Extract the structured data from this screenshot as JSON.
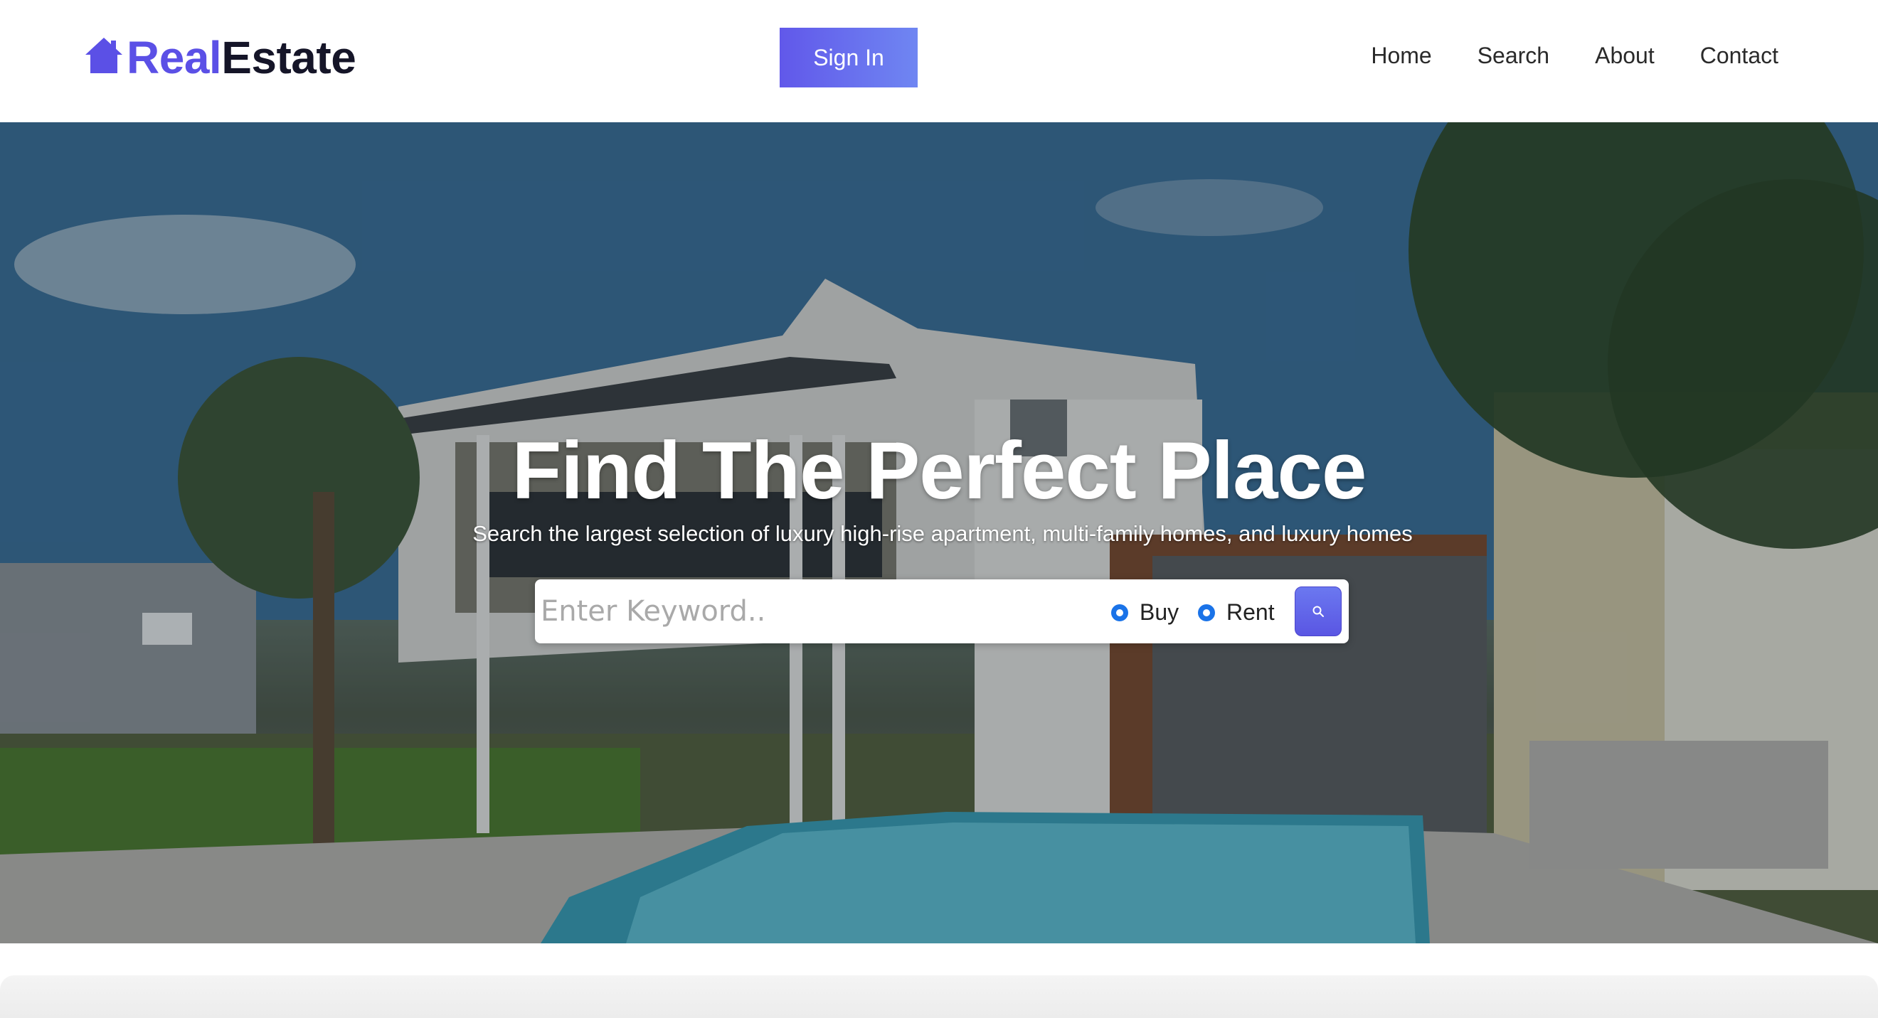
{
  "header": {
    "logo_real": "Real",
    "logo_estate": "Estate",
    "signin_label": "Sign In",
    "nav": [
      "Home",
      "Search",
      "About",
      "Contact"
    ]
  },
  "hero": {
    "title": "Find The Perfect Place",
    "subtitle": "Search the largest selection of luxury high-rise apartment, multi-family homes, and luxury homes",
    "search": {
      "placeholder": "Enter Keyword..",
      "options": [
        "Buy",
        "Rent"
      ],
      "selected_color": "#1a73e8"
    }
  },
  "colors": {
    "brand": "#5b50e6",
    "button_start": "#6158ea",
    "button_end": "#6f86f2"
  },
  "icons": {
    "logo": "house-icon",
    "search": "magnifier-icon"
  }
}
